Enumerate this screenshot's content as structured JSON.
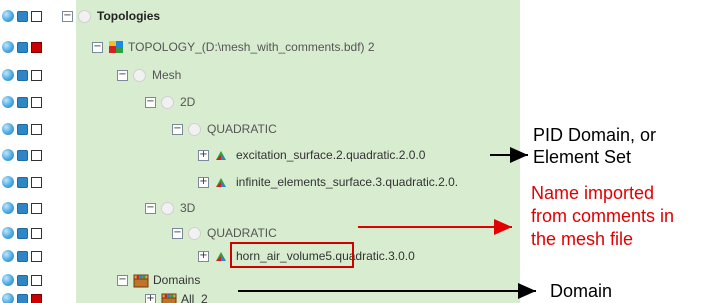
{
  "tree": {
    "root": "Topologies",
    "topology": "TOPOLOGY_(D:\\mesh_with_comments.bdf) 2",
    "mesh": "Mesh",
    "d2": "2D",
    "quad2": "QUADRATIC",
    "surface1": "excitation_surface.2.quadratic.2.0.0",
    "surface2": "infinite_elements_surface.3.quadratic.2.0.",
    "d3": "3D",
    "quad3": "QUADRATIC",
    "volume_name": "horn_air_volume",
    "volume_suffix": "5.quadratic.3.0.0",
    "domains": "Domains",
    "all": "All_2"
  },
  "annotations": {
    "pid_line1": "PID Domain, or",
    "pid_line2": "Element Set",
    "name_line1": "Name imported",
    "name_line2": "from comments in",
    "name_line3": "the mesh file",
    "domain": "Domain"
  },
  "colors": {
    "tree_background": "#d8ecd0",
    "highlight": "#d00000",
    "annotation_red": "#e00000"
  },
  "icons": {
    "visibility": "eye-dot-icon",
    "color": "color-square-icon",
    "selection": "checkbox-icon"
  }
}
